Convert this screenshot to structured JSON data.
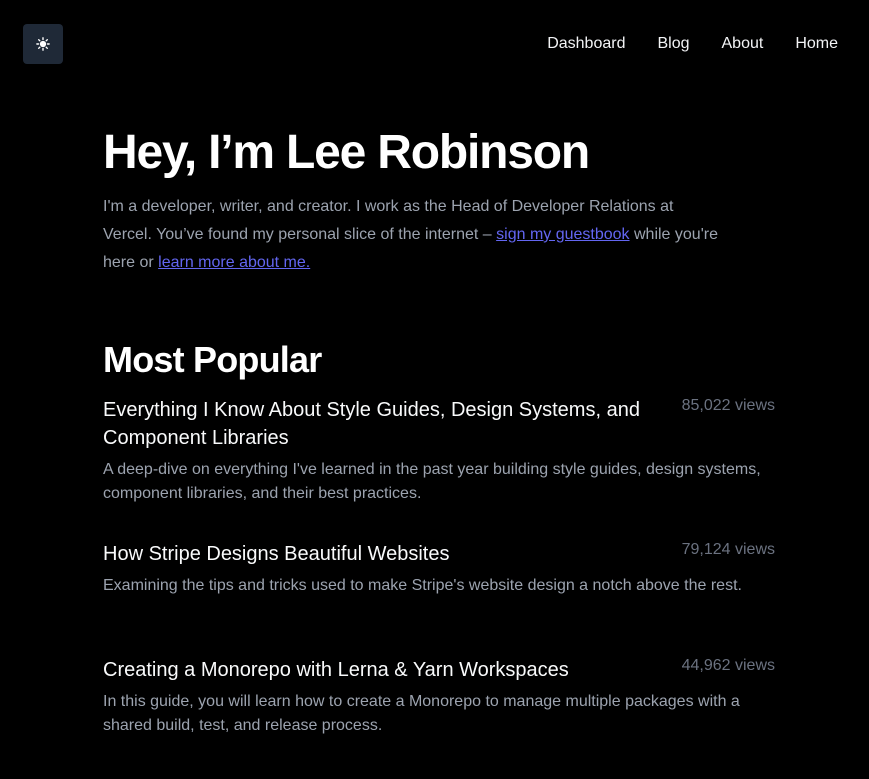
{
  "header": {
    "theme_toggle_icon": "sun-icon",
    "nav": [
      {
        "label": "Dashboard"
      },
      {
        "label": "Blog"
      },
      {
        "label": "About"
      },
      {
        "label": "Home"
      }
    ]
  },
  "hero": {
    "title": "Hey, I’m Lee Robinson",
    "intro_text": "I'm a developer, writer, and creator. I work as the Head of Developer Relations at Vercel. You’ve found my personal slice of the internet – ",
    "guestbook_link": "sign my guestbook",
    "intro_middle": " while you're here or ",
    "about_link": "learn more about me."
  },
  "popular": {
    "heading": "Most Popular",
    "posts": [
      {
        "title": "Everything I Know About Style Guides, Design Systems, and Component Libraries",
        "views": "85,022 views",
        "description": "A deep-dive on everything I've learned in the past year building style guides, design systems, component libraries, and their best practices."
      },
      {
        "title": "How Stripe Designs Beautiful Websites",
        "views": "79,124 views",
        "description": "Examining the tips and tricks used to make Stripe's website design a notch above the rest."
      },
      {
        "title": "Creating a Monorepo with Lerna & Yarn Workspaces",
        "views": "44,962 views",
        "description": "In this guide, you will learn how to create a Monorepo to manage multiple packages with a shared build, test, and release process."
      }
    ]
  },
  "colors": {
    "background": "#000000",
    "link": "#6366f1",
    "muted_text": "#9ca3af",
    "views_text": "#6b7280",
    "toggle_bg": "#1f2937"
  }
}
